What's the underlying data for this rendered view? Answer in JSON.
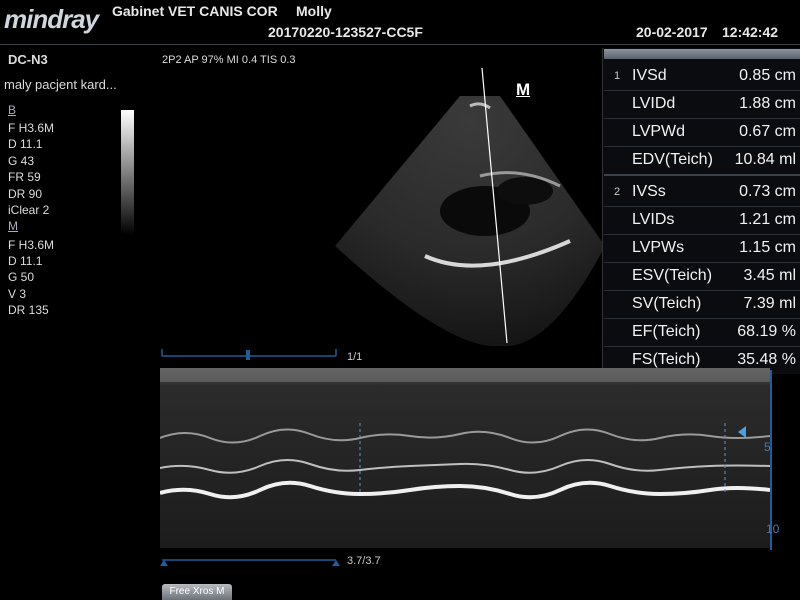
{
  "header": {
    "brand": "mindray",
    "clinic": "Gabinet VET CANIS COR",
    "patient": "Molly",
    "exam_id": "20170220-123527-CC5F",
    "date": "20-02-2017",
    "time": "12:42:42"
  },
  "probe": {
    "name": "DC-N3",
    "patient_type": "maly pacjent kard..."
  },
  "scan_params": "2P2  AP 97%  MI 0.4  TIS 0.3",
  "b_mode": {
    "label": "B",
    "params": [
      "F H3.6M",
      "D 11.1",
      "G 43",
      "FR 59",
      "DR 90",
      "iClear 2"
    ]
  },
  "m_mode": {
    "label": "M",
    "params": [
      "F H3.6M",
      "D 11.1",
      "G 50",
      "V 3",
      "DR 135"
    ]
  },
  "m_marker": "M",
  "frame_counter": "1/1",
  "cine_counter": "3.7/3.7",
  "depth_scale": [
    "5",
    "10"
  ],
  "measurements": [
    {
      "idx": "1",
      "name": "IVSd",
      "value": "0.85 cm"
    },
    {
      "idx": "",
      "name": "LVIDd",
      "value": "1.88 cm"
    },
    {
      "idx": "",
      "name": "LVPWd",
      "value": "0.67 cm"
    },
    {
      "idx": "",
      "name": "EDV(Teich)",
      "value": "10.84 ml"
    },
    {
      "idx": "2",
      "name": "IVSs",
      "value": "0.73 cm"
    },
    {
      "idx": "",
      "name": "LVIDs",
      "value": "1.21 cm"
    },
    {
      "idx": "",
      "name": "LVPWs",
      "value": "1.15 cm"
    },
    {
      "idx": "",
      "name": "ESV(Teich)",
      "value": "3.45 ml"
    },
    {
      "idx": "",
      "name": "SV(Teich)",
      "value": "7.39 ml"
    },
    {
      "idx": "",
      "name": "EF(Teich)",
      "value": "68.19 %"
    },
    {
      "idx": "",
      "name": "FS(Teich)",
      "value": "35.48 %"
    }
  ],
  "free_xros_button": "Free Xros M",
  "colors": {
    "accent": "#cfd6de",
    "panel": "#0a0c0f",
    "scale": "#1e5c9c"
  }
}
